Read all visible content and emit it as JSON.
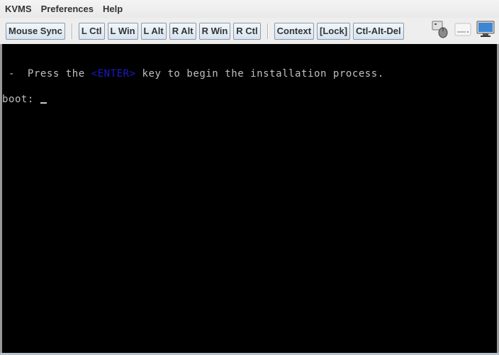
{
  "menubar": {
    "items": [
      "KVMS",
      "Preferences",
      "Help"
    ]
  },
  "toolbar": {
    "mouse_sync": "Mouse Sync",
    "keys": [
      "L Ctl",
      "L Win",
      "L Alt",
      "R Alt",
      "R Win",
      "R Ctl"
    ],
    "actions": [
      "Context",
      "[Lock]",
      "Ctl-Alt-Del"
    ],
    "status_icons": [
      "keyboard-mouse-icon",
      "drive-icon",
      "monitor-icon"
    ]
  },
  "console": {
    "line1_prefix": " -  Press the ",
    "line1_key": "<ENTER>",
    "line1_suffix": " key to begin the installation process.",
    "prompt": "boot: ",
    "key_color": "#1a1ac8"
  }
}
